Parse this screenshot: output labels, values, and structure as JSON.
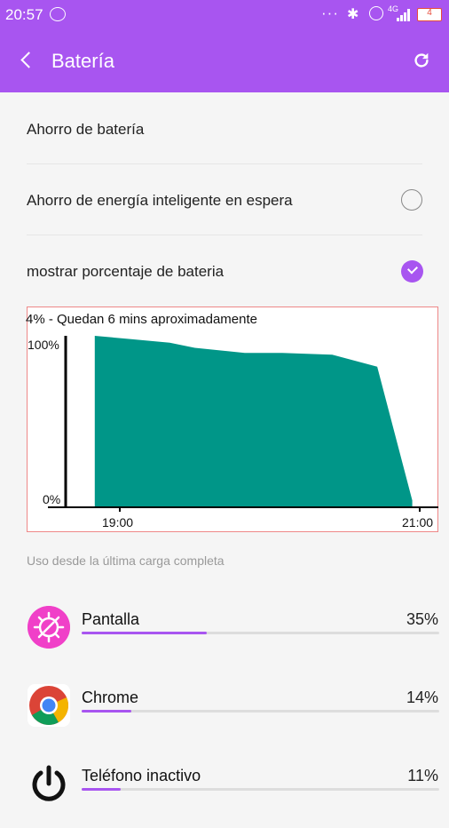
{
  "status_bar": {
    "time": "20:57",
    "network": "4G",
    "battery_level": "4"
  },
  "header": {
    "title": "Batería"
  },
  "settings": {
    "battery_saver": "Ahorro de batería",
    "smart_saver": "Ahorro de energía inteligente en espera",
    "show_percentage": "mostrar porcentaje de bateria",
    "smart_saver_checked": false,
    "show_percentage_checked": true
  },
  "chart_data": {
    "type": "area",
    "title": "4% - Quedan 6 mins aproximadamente",
    "x_ticks": [
      "19:00",
      "21:00"
    ],
    "y_ticks": [
      "100%",
      "0%"
    ],
    "ylim": [
      0,
      100
    ],
    "x": [
      "18:50",
      "19:20",
      "19:30",
      "19:50",
      "20:05",
      "20:25",
      "20:43",
      "20:57"
    ],
    "values": [
      100,
      96,
      93,
      90,
      90,
      89,
      82,
      4
    ],
    "color": "#009688"
  },
  "usage": {
    "section_label": "Uso desde la última carga completa",
    "items": [
      {
        "name": "Pantalla",
        "percent_label": "35%",
        "percent": 35,
        "icon": "screen-icon"
      },
      {
        "name": "Chrome",
        "percent_label": "14%",
        "percent": 14,
        "icon": "chrome-icon"
      },
      {
        "name": "Teléfono inactivo",
        "percent_label": "11%",
        "percent": 11,
        "icon": "power-icon"
      }
    ]
  },
  "colors": {
    "accent": "#a855f0",
    "chart_fill": "#009688"
  }
}
